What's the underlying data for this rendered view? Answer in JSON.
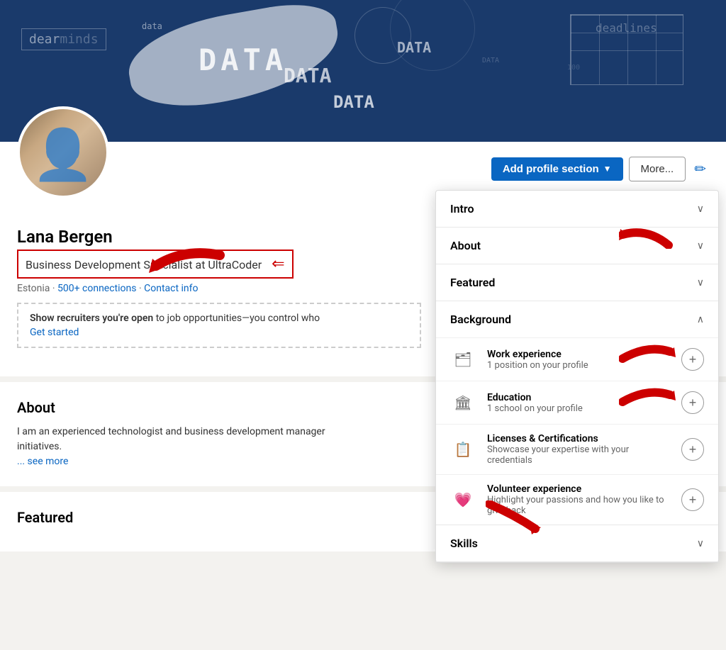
{
  "banner": {
    "alt": "Data themed banner"
  },
  "profile": {
    "name": "Lana Bergen",
    "headline": "Business Development Specialist at UltraCoder",
    "location": "Estonia",
    "connections": "500+ connections",
    "contact_info": "Contact info",
    "open_to_work": {
      "text_bold": "Show recruiters you're open",
      "text_normal": " to job opportunities—you control who",
      "cta": "Get started"
    }
  },
  "actions": {
    "add_profile_section": "Add profile section",
    "more": "More...",
    "edit_pencil": "✏"
  },
  "about_section": {
    "title": "About",
    "body": "I am an experienced technologist and business development manager",
    "body2": "initiatives.",
    "see_more": "... see more"
  },
  "featured_section": {
    "title": "Featured"
  },
  "dropdown": {
    "sections": [
      {
        "id": "intro",
        "title": "Intro",
        "expanded": false,
        "chevron": "∨"
      },
      {
        "id": "about",
        "title": "About",
        "expanded": false,
        "chevron": "∨"
      },
      {
        "id": "featured",
        "title": "Featured",
        "expanded": false,
        "chevron": "∨"
      },
      {
        "id": "background",
        "title": "Background",
        "expanded": true,
        "chevron": "∧",
        "subsections": [
          {
            "id": "work-experience",
            "icon": "🗂",
            "title": "Work experience",
            "desc": "1 position on your profile",
            "has_add": true
          },
          {
            "id": "education",
            "icon": "🏛",
            "title": "Education",
            "desc": "1 school on your profile",
            "has_add": true
          },
          {
            "id": "licenses",
            "icon": "📋",
            "title": "Licenses & Certifications",
            "desc": "Showcase your expertise with your credentials",
            "has_add": true
          },
          {
            "id": "volunteer",
            "icon": "💗",
            "title": "Volunteer experience",
            "desc": "Highlight your passions and how you like to give back",
            "has_add": true
          }
        ]
      },
      {
        "id": "skills",
        "title": "Skills",
        "expanded": false,
        "chevron": "∨"
      }
    ]
  }
}
